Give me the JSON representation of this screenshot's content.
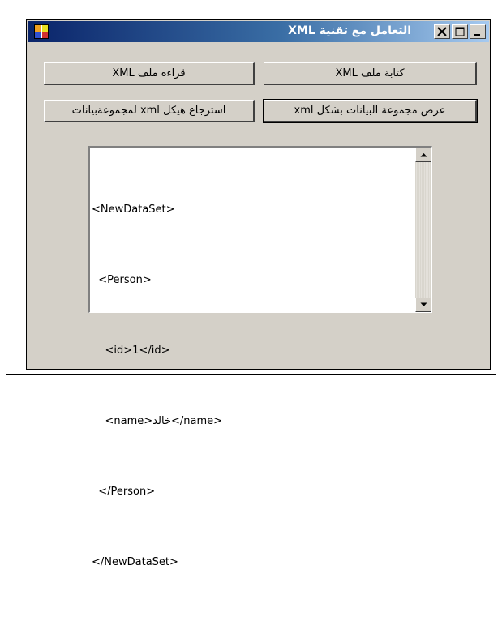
{
  "window": {
    "title": "التعامل مع تقنية XML"
  },
  "buttons": {
    "read_xml": "قراءة ملف XML",
    "write_xml": "كتابة ملف XML",
    "get_schema": "استرجاع هيكل xml لمجموعةبيانات",
    "show_dataset": "عرض مجموعة البيانات بشكل xml"
  },
  "textbox": {
    "lines": [
      "<NewDataSet>",
      "  <Person>",
      "    <id>1</id>",
      "    <name>خالد</name>",
      "  </Person>",
      "</NewDataSet>"
    ]
  },
  "icons": {
    "app": "app-icon",
    "minimize": "minimize-icon",
    "maximize": "maximize-icon",
    "close": "close-icon",
    "scroll_up": "scroll-up-arrow-icon",
    "scroll_down": "scroll-down-arrow-icon"
  },
  "colors": {
    "titlebar_start": "#0a246a",
    "titlebar_end": "#a6caf0",
    "window_face": "#d4d0c8"
  }
}
